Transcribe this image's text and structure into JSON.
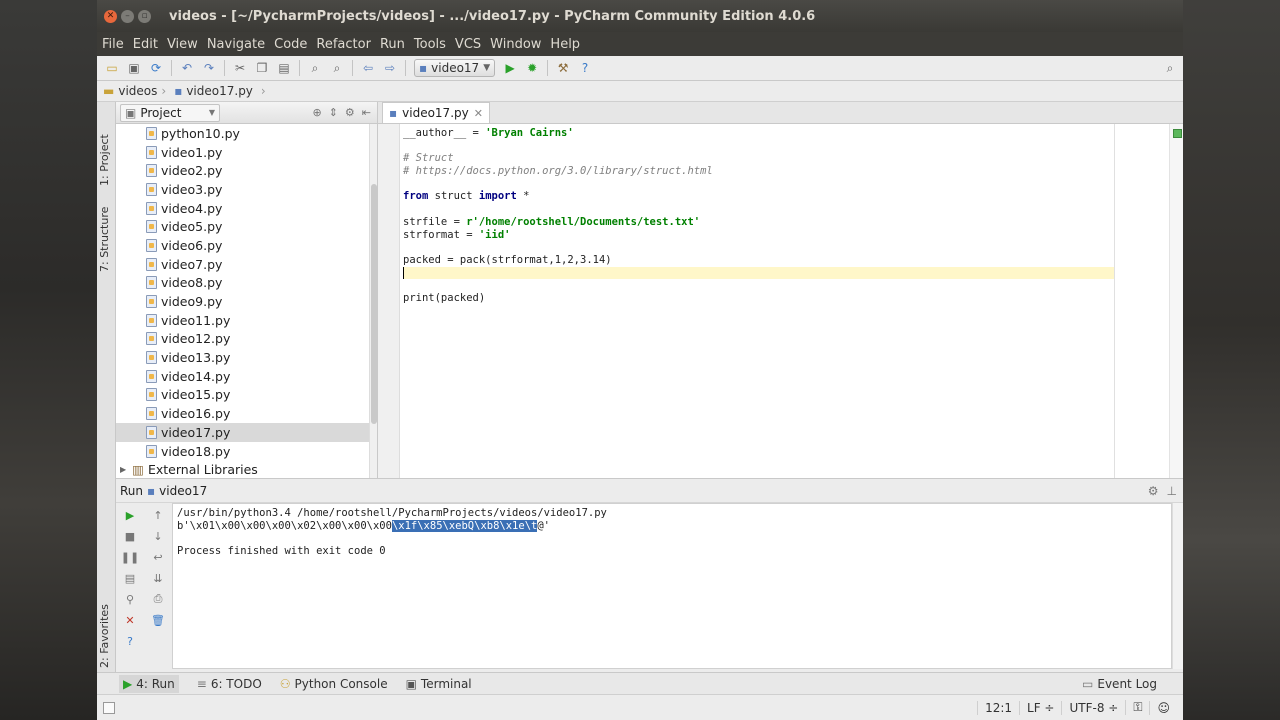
{
  "window": {
    "title": "videos - [~/PycharmProjects/videos] - .../video17.py - PyCharm Community Edition 4.0.6"
  },
  "menu": [
    "File",
    "Edit",
    "View",
    "Navigate",
    "Code",
    "Refactor",
    "Run",
    "Tools",
    "VCS",
    "Window",
    "Help"
  ],
  "toolbar": {
    "run_config": "video17"
  },
  "breadcrumb": {
    "root": "videos",
    "file": "video17.py"
  },
  "side_tabs": {
    "project": "1: Project",
    "structure": "7: Structure",
    "favorites": "2: Favorites"
  },
  "project": {
    "header": "Project",
    "files": [
      "python10.py",
      "video1.py",
      "video2.py",
      "video3.py",
      "video4.py",
      "video5.py",
      "video6.py",
      "video7.py",
      "video8.py",
      "video9.py",
      "video11.py",
      "video12.py",
      "video13.py",
      "video14.py",
      "video15.py",
      "video16.py",
      "video17.py",
      "video18.py"
    ],
    "selected": "video17.py",
    "external": "External Libraries"
  },
  "editor": {
    "tab": "video17.py",
    "lines": {
      "l1a": "__author__ = ",
      "l1b": "'Bryan Cairns'",
      "l3": "# Struct",
      "l4": "# https://docs.python.org/3.0/library/struct.html",
      "l6a": "from",
      "l6b": " struct ",
      "l6c": "import",
      "l6d": " *",
      "l8a": "strfile = ",
      "l8b": "r'/home/rootshell/Documents/test.txt'",
      "l9a": "strformat = ",
      "l9b": "'iid'",
      "l11": "packed = pack(strformat,1,2,3.14)",
      "l14": "print(packed)"
    }
  },
  "run": {
    "label": "Run",
    "config": "video17",
    "line1": "/usr/bin/python3.4 /home/rootshell/PycharmProjects/videos/video17.py",
    "line2a": "b'\\x01\\x00\\x00\\x00\\x02\\x00\\x00\\x00",
    "line2b": "\\x1f\\x85\\xebQ\\xb8\\x1e\\t",
    "line2c": "@'",
    "line4": "Process finished with exit code 0"
  },
  "bottom_tabs": {
    "run": "4: Run",
    "todo": "6: TODO",
    "console": "Python Console",
    "terminal": "Terminal",
    "event_log": "Event Log"
  },
  "status": {
    "position": "12:1",
    "line_sep": "LF ÷",
    "encoding": "UTF-8 ÷"
  }
}
